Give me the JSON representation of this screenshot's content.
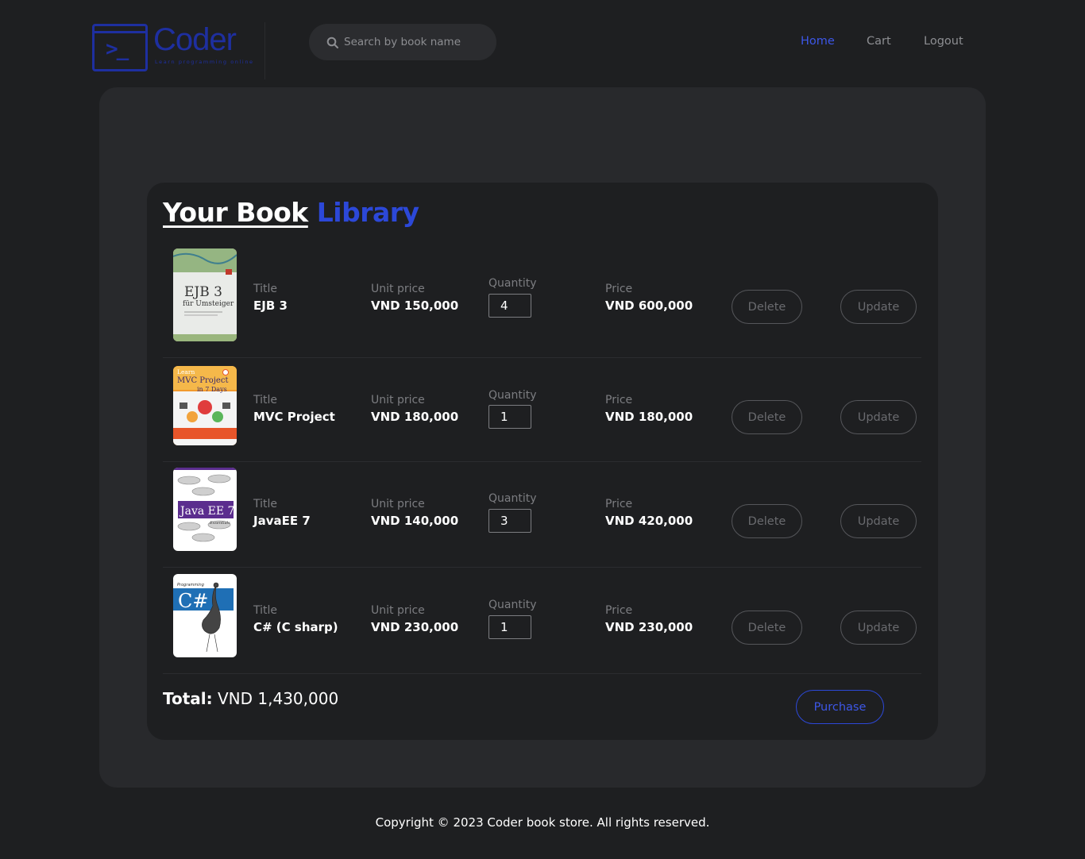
{
  "header": {
    "logo_text": "Coder",
    "logo_tagline": "Learn programming online",
    "logo_prompt": ">_",
    "search_placeholder": "Search by book name",
    "nav": {
      "home": "Home",
      "cart": "Cart",
      "logout": "Logout"
    }
  },
  "library": {
    "title_part1": "Your Book",
    "title_part2": "Library",
    "labels": {
      "title": "Title",
      "unit_price": "Unit price",
      "quantity": "Quantity",
      "price": "Price"
    },
    "buttons": {
      "delete": "Delete",
      "update": "Update"
    },
    "items": [
      {
        "title": "EJB 3",
        "unit_price": "VND 150,000",
        "quantity": "4",
        "price": "VND 600,000",
        "cover": {
          "line1": "EJB 3",
          "line2": "für Umsteiger"
        }
      },
      {
        "title": "MVC Project",
        "unit_price": "VND 180,000",
        "quantity": "1",
        "price": "VND 180,000",
        "cover": {
          "line1": "Learn",
          "line2": "MVC Project",
          "line3": "in 7 Days"
        }
      },
      {
        "title": "JavaEE 7",
        "unit_price": "VND 140,000",
        "quantity": "3",
        "price": "VND 420,000",
        "cover": {
          "line1": "Java EE 7",
          "line2": "Essentials"
        }
      },
      {
        "title": "C# (C sharp)",
        "unit_price": "VND 230,000",
        "quantity": "1",
        "price": "VND 230,000",
        "cover": {
          "line1": "Programming",
          "line2": "C#"
        }
      }
    ],
    "total_label": "Total:",
    "total_value": "VND 1,430,000",
    "purchase_label": "Purchase"
  },
  "footer": {
    "copyright": "Copyright © 2023 Coder book store. All rights reserved."
  },
  "colors": {
    "accent": "#2c48d8",
    "background": "#1e1f21",
    "panel": "#28292c"
  }
}
